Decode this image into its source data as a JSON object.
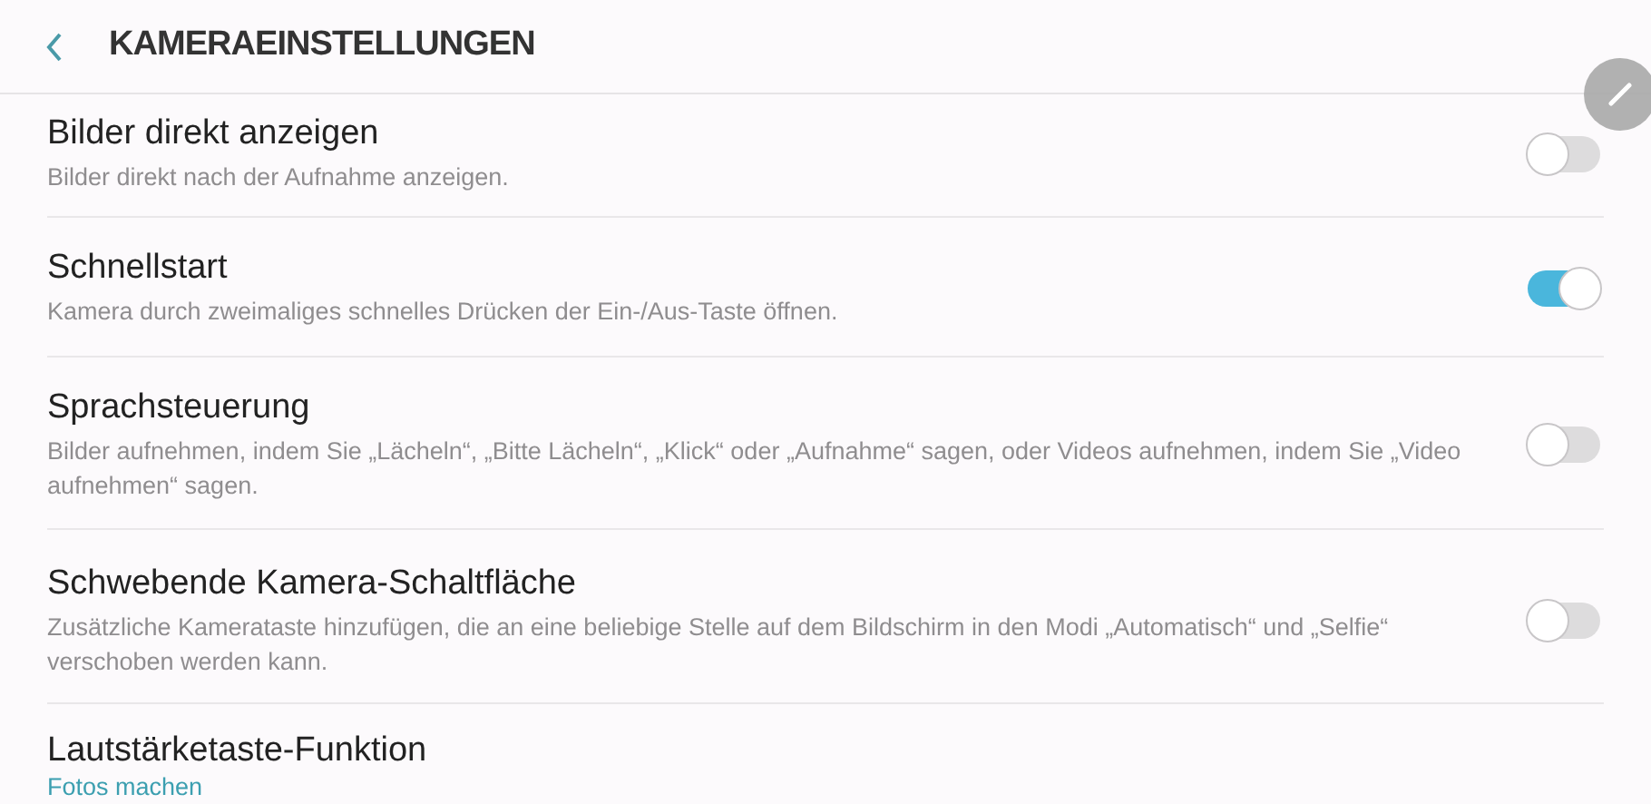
{
  "header": {
    "title": "KAMERAEINSTELLUNGEN"
  },
  "settings": [
    {
      "kind": "toggle",
      "title": "Bilder direkt anzeigen",
      "description": "Bilder direkt nach der Aufnahme anzeigen.",
      "on": false
    },
    {
      "kind": "toggle",
      "title": "Schnellstart",
      "description": "Kamera durch zweimaliges schnelles Drücken der Ein-/Aus-Taste öffnen.",
      "on": true
    },
    {
      "kind": "toggle",
      "title": "Sprachsteuerung",
      "description": "Bilder aufnehmen, indem Sie „Lächeln“, „Bitte Lächeln“, „Klick“ oder „Aufnahme“ sagen, oder Videos aufnehmen, indem Sie „Video aufnehmen“ sagen.",
      "on": false
    },
    {
      "kind": "toggle",
      "title": "Schwebende Kamera-Schaltfläche",
      "description": "Zusätzliche Kamerataste hinzufügen, die an eine beliebige Stelle auf dem Bildschirm in den Modi „Automatisch“ und „Selfie“ verschoben werden kann.",
      "on": false
    },
    {
      "kind": "value",
      "title": "Lautstärketaste-Funktion",
      "value": "Fotos machen"
    }
  ]
}
